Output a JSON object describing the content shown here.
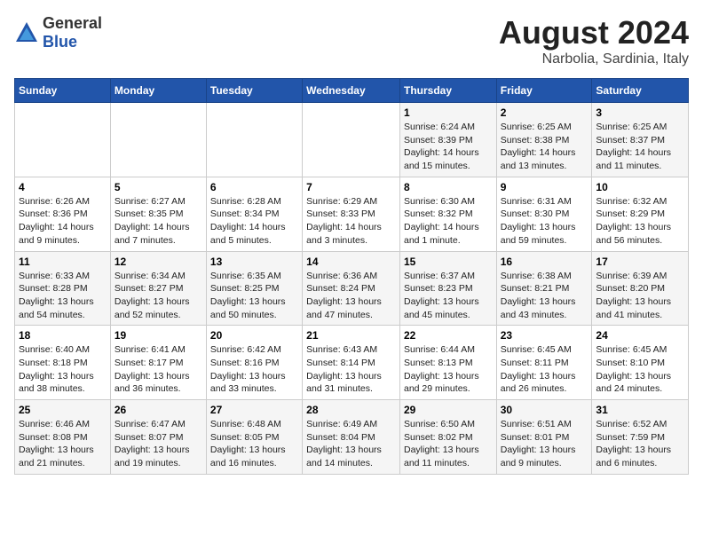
{
  "logo": {
    "general": "General",
    "blue": "Blue"
  },
  "title": "August 2024",
  "subtitle": "Narbolia, Sardinia, Italy",
  "weekdays": [
    "Sunday",
    "Monday",
    "Tuesday",
    "Wednesday",
    "Thursday",
    "Friday",
    "Saturday"
  ],
  "weeks": [
    [
      {
        "day": "",
        "info": ""
      },
      {
        "day": "",
        "info": ""
      },
      {
        "day": "",
        "info": ""
      },
      {
        "day": "",
        "info": ""
      },
      {
        "day": "1",
        "info": "Sunrise: 6:24 AM\nSunset: 8:39 PM\nDaylight: 14 hours and 15 minutes."
      },
      {
        "day": "2",
        "info": "Sunrise: 6:25 AM\nSunset: 8:38 PM\nDaylight: 14 hours and 13 minutes."
      },
      {
        "day": "3",
        "info": "Sunrise: 6:25 AM\nSunset: 8:37 PM\nDaylight: 14 hours and 11 minutes."
      }
    ],
    [
      {
        "day": "4",
        "info": "Sunrise: 6:26 AM\nSunset: 8:36 PM\nDaylight: 14 hours and 9 minutes."
      },
      {
        "day": "5",
        "info": "Sunrise: 6:27 AM\nSunset: 8:35 PM\nDaylight: 14 hours and 7 minutes."
      },
      {
        "day": "6",
        "info": "Sunrise: 6:28 AM\nSunset: 8:34 PM\nDaylight: 14 hours and 5 minutes."
      },
      {
        "day": "7",
        "info": "Sunrise: 6:29 AM\nSunset: 8:33 PM\nDaylight: 14 hours and 3 minutes."
      },
      {
        "day": "8",
        "info": "Sunrise: 6:30 AM\nSunset: 8:32 PM\nDaylight: 14 hours and 1 minute."
      },
      {
        "day": "9",
        "info": "Sunrise: 6:31 AM\nSunset: 8:30 PM\nDaylight: 13 hours and 59 minutes."
      },
      {
        "day": "10",
        "info": "Sunrise: 6:32 AM\nSunset: 8:29 PM\nDaylight: 13 hours and 56 minutes."
      }
    ],
    [
      {
        "day": "11",
        "info": "Sunrise: 6:33 AM\nSunset: 8:28 PM\nDaylight: 13 hours and 54 minutes."
      },
      {
        "day": "12",
        "info": "Sunrise: 6:34 AM\nSunset: 8:27 PM\nDaylight: 13 hours and 52 minutes."
      },
      {
        "day": "13",
        "info": "Sunrise: 6:35 AM\nSunset: 8:25 PM\nDaylight: 13 hours and 50 minutes."
      },
      {
        "day": "14",
        "info": "Sunrise: 6:36 AM\nSunset: 8:24 PM\nDaylight: 13 hours and 47 minutes."
      },
      {
        "day": "15",
        "info": "Sunrise: 6:37 AM\nSunset: 8:23 PM\nDaylight: 13 hours and 45 minutes."
      },
      {
        "day": "16",
        "info": "Sunrise: 6:38 AM\nSunset: 8:21 PM\nDaylight: 13 hours and 43 minutes."
      },
      {
        "day": "17",
        "info": "Sunrise: 6:39 AM\nSunset: 8:20 PM\nDaylight: 13 hours and 41 minutes."
      }
    ],
    [
      {
        "day": "18",
        "info": "Sunrise: 6:40 AM\nSunset: 8:18 PM\nDaylight: 13 hours and 38 minutes."
      },
      {
        "day": "19",
        "info": "Sunrise: 6:41 AM\nSunset: 8:17 PM\nDaylight: 13 hours and 36 minutes."
      },
      {
        "day": "20",
        "info": "Sunrise: 6:42 AM\nSunset: 8:16 PM\nDaylight: 13 hours and 33 minutes."
      },
      {
        "day": "21",
        "info": "Sunrise: 6:43 AM\nSunset: 8:14 PM\nDaylight: 13 hours and 31 minutes."
      },
      {
        "day": "22",
        "info": "Sunrise: 6:44 AM\nSunset: 8:13 PM\nDaylight: 13 hours and 29 minutes."
      },
      {
        "day": "23",
        "info": "Sunrise: 6:45 AM\nSunset: 8:11 PM\nDaylight: 13 hours and 26 minutes."
      },
      {
        "day": "24",
        "info": "Sunrise: 6:45 AM\nSunset: 8:10 PM\nDaylight: 13 hours and 24 minutes."
      }
    ],
    [
      {
        "day": "25",
        "info": "Sunrise: 6:46 AM\nSunset: 8:08 PM\nDaylight: 13 hours and 21 minutes."
      },
      {
        "day": "26",
        "info": "Sunrise: 6:47 AM\nSunset: 8:07 PM\nDaylight: 13 hours and 19 minutes."
      },
      {
        "day": "27",
        "info": "Sunrise: 6:48 AM\nSunset: 8:05 PM\nDaylight: 13 hours and 16 minutes."
      },
      {
        "day": "28",
        "info": "Sunrise: 6:49 AM\nSunset: 8:04 PM\nDaylight: 13 hours and 14 minutes."
      },
      {
        "day": "29",
        "info": "Sunrise: 6:50 AM\nSunset: 8:02 PM\nDaylight: 13 hours and 11 minutes."
      },
      {
        "day": "30",
        "info": "Sunrise: 6:51 AM\nSunset: 8:01 PM\nDaylight: 13 hours and 9 minutes."
      },
      {
        "day": "31",
        "info": "Sunrise: 6:52 AM\nSunset: 7:59 PM\nDaylight: 13 hours and 6 minutes."
      }
    ]
  ]
}
